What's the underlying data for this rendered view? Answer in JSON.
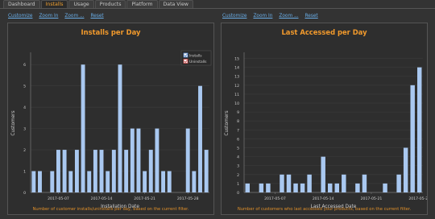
{
  "tabs": [
    "Dashboard",
    "Installs",
    "Usage",
    "Products",
    "Platform",
    "Data View"
  ],
  "active_tab": "Installs",
  "toolbar_links": [
    "Customize",
    "Zoom In",
    "Zoom ...",
    "Reset"
  ],
  "left_panel": {
    "footer": "Number of customer installs/uninstalls per day, based on the current filter."
  },
  "right_panel": {
    "footer": "Number of customers who last accessed your products, based on the current filter."
  },
  "colors": {
    "bar": "#a9c8f0",
    "title": "#f29a2c",
    "grid": "#3c3c3c",
    "axis": "#777777",
    "text": "#cfcfcf"
  },
  "chart_data": [
    {
      "type": "bar",
      "title": "Installs per Day",
      "xlabel": "Installation Date",
      "ylabel": "Customers",
      "ylim": [
        0,
        6.5
      ],
      "yticks": [
        0,
        1,
        2,
        3,
        4,
        5,
        6
      ],
      "xtick_labels": [
        "2017-05-07",
        "2017-05-14",
        "2017-05-21",
        "2017-05-28"
      ],
      "legend": [
        "Installs",
        "Uninstalls"
      ],
      "legend_position": "top-right",
      "x_start": "2017-05-03",
      "series": [
        {
          "name": "Installs",
          "values": [
            1,
            1,
            null,
            1,
            2,
            2,
            1,
            2,
            6,
            1,
            2,
            2,
            1,
            2,
            6,
            2,
            3,
            3,
            1,
            2,
            3,
            1,
            1,
            null,
            null,
            3,
            1,
            5,
            2
          ]
        }
      ]
    },
    {
      "type": "bar",
      "title": "Last Accessed per Day",
      "xlabel": "Last Accessed Date",
      "ylabel": "Customers",
      "ylim": [
        0,
        15.5
      ],
      "yticks": [
        0,
        1,
        2,
        3,
        4,
        5,
        6,
        7,
        8,
        9,
        10,
        11,
        12,
        13,
        14,
        15
      ],
      "xtick_labels": [
        "2017-05-07",
        "2017-05-14",
        "2017-05-21",
        "2017-05-28"
      ],
      "x_start": "2017-05-03",
      "series": [
        {
          "values": [
            1,
            null,
            1,
            1,
            null,
            2,
            2,
            1,
            1,
            2,
            null,
            4,
            1,
            1,
            2,
            null,
            1,
            2,
            null,
            null,
            1,
            null,
            2,
            5,
            12,
            14
          ]
        }
      ]
    }
  ]
}
